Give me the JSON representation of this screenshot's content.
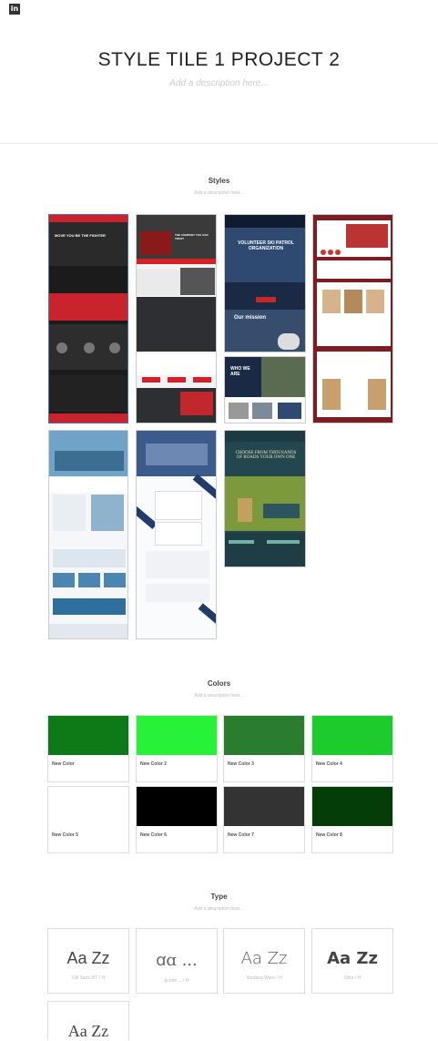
{
  "header": {
    "logo": "in",
    "title": "STYLE TILE 1 PROJECT 2",
    "description": "Add a description here..."
  },
  "styles": {
    "title": "Styles",
    "description": "Add a description here...",
    "tiles": [
      {
        "headline": "MOVE YOU BE THE FIGHTER"
      },
      {
        "headline": "THE COMPANY YOU CAN TRUST"
      },
      {
        "headline": "VOLUNTEER SKI PATROL ORGANIZATION",
        "sub": "Our mission",
        "sub2": "WHO WE ARE"
      },
      {
        "headline": ""
      },
      {
        "headline": ""
      },
      {
        "headline": ""
      },
      {
        "headline": "CHOOSE FROM THOUSANDS OF ROADS YOUR OWN ONE"
      }
    ]
  },
  "colors": {
    "title": "Colors",
    "description": "Add a description here...",
    "swatches": [
      {
        "label": "New Color",
        "hex": "#0b7a17"
      },
      {
        "label": "New Color 2",
        "hex": "#27f237"
      },
      {
        "label": "New Color 3",
        "hex": "#2a7d2f"
      },
      {
        "label": "New Color 4",
        "hex": "#1ccc2c"
      },
      {
        "label": "New Color 5",
        "hex": "#ffffff"
      },
      {
        "label": "New Color 6",
        "hex": "#000000"
      },
      {
        "label": "New Color 7",
        "hex": "#333333"
      },
      {
        "label": "New Color 8",
        "hex": "#053d09"
      }
    ]
  },
  "type": {
    "title": "Type",
    "description": "Add a description here...",
    "fonts": [
      {
        "sample": "Aa Zz",
        "name": "Gill Sans MT / H"
      },
      {
        "sample": "ꭤɑ ...",
        "name": "gcode ... / H"
      },
      {
        "sample": "Aa Zz",
        "name": "Verdana Ware / H"
      },
      {
        "sample": "Aa Zz",
        "name": "Ultra / H"
      },
      {
        "sample": "Aa Zz",
        "name": ""
      }
    ]
  }
}
